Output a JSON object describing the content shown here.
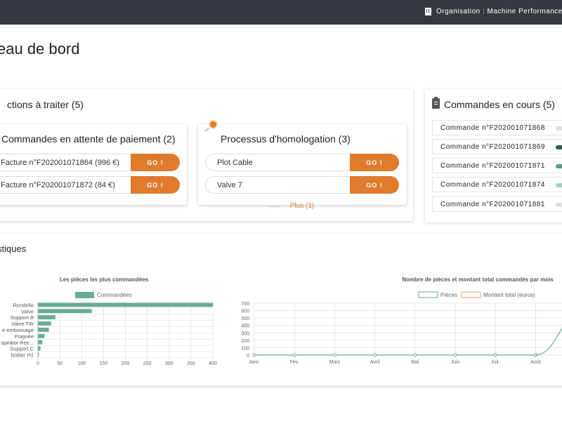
{
  "topbar": {
    "organisation": "Organisation : Machine Performance"
  },
  "page": {
    "title": "eau de bord"
  },
  "actions": {
    "title": "ctions à traiter (5)",
    "payments": {
      "title": "Commandes en attente de paiement (2)",
      "items": [
        {
          "label": "Facture n°F202001071864 (996 €)",
          "button": "GO !"
        },
        {
          "label": "Facture n°F202001071872 (84 €)",
          "button": "GO !"
        }
      ]
    },
    "homologation": {
      "title": "Processus d'homologation (3)",
      "items": [
        {
          "label": "Plot Cable",
          "button": "GO !"
        },
        {
          "label": "Valve 7",
          "button": "GO !"
        }
      ],
      "more": "Plus (1)"
    }
  },
  "orders": {
    "title": "Commandes en cours (5)",
    "items": [
      {
        "label": "Commande n°F202001071868",
        "status_color": "#e0e0e0"
      },
      {
        "label": "Commande n°F202001071869",
        "status_color": "#2f5e4f"
      },
      {
        "label": "Commande n°F202001071871",
        "status_color": "#5a9b86"
      },
      {
        "label": "Commande n°F202001071874",
        "status_color": "#9fd0c0"
      },
      {
        "label": "Commande n°F202001071881",
        "status_color": "#e0e0e0"
      }
    ]
  },
  "stats": {
    "title": "stiques"
  },
  "colors": {
    "accent": "#e07b2d",
    "bar": "#6aab94",
    "line_pieces": "#6aab94",
    "line_montant": "#f0a060"
  },
  "chart_data": [
    {
      "type": "bar",
      "orientation": "horizontal",
      "title": "Les  pièces les plus commandées",
      "categories": [
        "Rondelle",
        "Valve",
        "Support B",
        "Valve TW",
        "e embossage",
        "Poignée",
        "spirator-free...",
        "Support C",
        "boitier H1"
      ],
      "series": [
        {
          "name": "Commandées",
          "values": [
            400,
            123,
            40,
            30,
            25,
            15,
            10,
            6,
            2
          ]
        }
      ],
      "xlim": [
        0,
        400
      ],
      "xticks": [
        "0",
        "50",
        "100",
        "150",
        "200",
        "250",
        "300",
        "350",
        "400"
      ],
      "grid": true,
      "legend": "top"
    },
    {
      "type": "line",
      "title": "Nombre de pièces et montant total commandés par mois",
      "categories": [
        "Janv.",
        "Fév.",
        "Mars",
        "Avril",
        "Mai",
        "Juin",
        "Juil.",
        "Août"
      ],
      "series": [
        {
          "name": "Pièces",
          "values": [
            0,
            0,
            0,
            0,
            0,
            0,
            0,
            0
          ]
        },
        {
          "name": "Montant total (euros)",
          "values": []
        }
      ],
      "trailing_rise": {
        "from": "Août",
        "to_value": 400
      },
      "ylim": [
        0,
        700
      ],
      "yticks": [
        "0",
        "100",
        "200",
        "300",
        "400",
        "500",
        "600",
        "700"
      ],
      "grid": true,
      "legend": "top"
    }
  ]
}
